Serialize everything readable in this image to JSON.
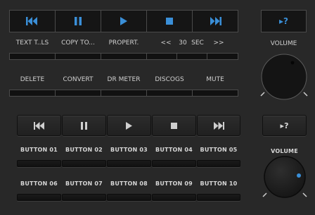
{
  "colors": {
    "accent": "#3a8fd8",
    "background": "#282828"
  },
  "top_panel": {
    "transport": [
      {
        "name": "previous",
        "icon": "skip-back-icon"
      },
      {
        "name": "pause",
        "icon": "pause-icon"
      },
      {
        "name": "play",
        "icon": "play-icon"
      },
      {
        "name": "stop",
        "icon": "stop-icon"
      },
      {
        "name": "next",
        "icon": "skip-forward-icon"
      }
    ],
    "help_button": "▸?",
    "row1": [
      "TEXT T..LS",
      "COPY TO...",
      "PROPERT.",
      "",
      "",
      ""
    ],
    "skip": {
      "back": "<<",
      "value": "30",
      "unit": "SEC",
      "forward": ">>"
    },
    "row2": [
      "DELETE",
      "CONVERT",
      "DR METER",
      "DISCOGS",
      "MUTE"
    ],
    "volume_label": "VOLUME"
  },
  "bottom_panel": {
    "help_button": "▸?",
    "buttons_row1": [
      "BUTTON 01",
      "BUTTON 02",
      "BUTTON 03",
      "BUTTON 04",
      "BUTTON 05"
    ],
    "buttons_row2": [
      "BUTTON 06",
      "BUTTON 07",
      "BUTTON 08",
      "BUTTON 09",
      "BUTTON 10"
    ],
    "volume_label": "VOLUME"
  }
}
